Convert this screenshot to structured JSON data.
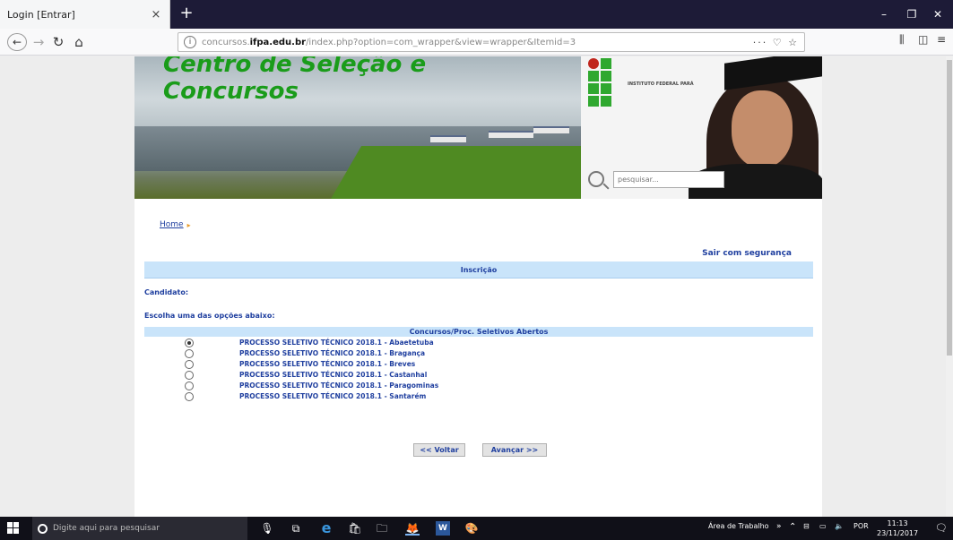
{
  "browser": {
    "tab_title": "Login [Entrar]",
    "tab_close": "×",
    "new_tab": "+",
    "url_prefix": "concursos.",
    "url_domain": "ifpa.edu.br",
    "url_path": "/index.php?option=com_wrapper&view=wrapper&Itemid=3",
    "url_actions": "··· ♡ ☆",
    "win_min": "–",
    "win_max": "❐",
    "win_close": "✕"
  },
  "banner": {
    "title_line1": "Centro de Seleção e",
    "title_line2": "Concursos",
    "logo_text": "INSTITUTO FEDERAL PARÁ",
    "search_placeholder": "pesquisar..."
  },
  "breadcrumb": {
    "home": "Home",
    "arrow": "▸"
  },
  "logout_label": "Sair com segurança",
  "inscricao_header": "Inscrição",
  "candidato_label": "Candidato:",
  "escolha_label": "Escolha uma das opções abaixo:",
  "concursos_header": "Concursos/Proc. Seletivos Abertos",
  "options": [
    {
      "label": "PROCESSO SELETIVO TÉCNICO 2018.1 - Abaetetuba",
      "checked": true
    },
    {
      "label": "PROCESSO SELETIVO TÉCNICO 2018.1 - Bragança",
      "checked": false
    },
    {
      "label": "PROCESSO SELETIVO TÉCNICO 2018.1 - Breves",
      "checked": false
    },
    {
      "label": "PROCESSO SELETIVO TÉCNICO 2018.1 - Castanhal",
      "checked": false
    },
    {
      "label": "PROCESSO SELETIVO TÉCNICO 2018.1 - Paragominas",
      "checked": false
    },
    {
      "label": "PROCESSO SELETIVO TÉCNICO 2018.1 - Santarém",
      "checked": false
    }
  ],
  "buttons": {
    "voltar": "<< Voltar",
    "avancar": "Avançar >>"
  },
  "taskbar": {
    "search_placeholder": "Digite aqui para pesquisar",
    "desktop_label": "Área de Trabalho",
    "language": "POR",
    "time": "11:13",
    "date": "23/11/2017"
  }
}
